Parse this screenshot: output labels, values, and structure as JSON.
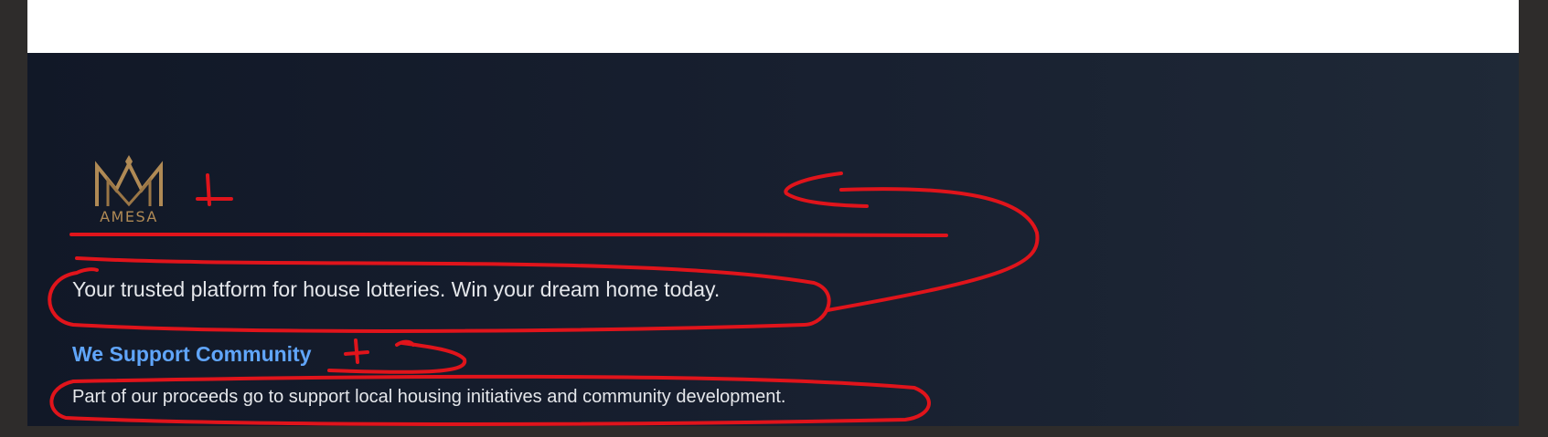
{
  "footer": {
    "logo": {
      "text": "AMESA",
      "icon": "crown-m-logo-icon"
    },
    "tagline": "Your trusted platform for house lotteries. Win your dream home today.",
    "support_heading": "We Support Community",
    "support_text": "Part of our proceeds go to support local housing initiatives and community development."
  },
  "colors": {
    "footer_background": "#111827",
    "logo_gold": "#b08a55",
    "heading_blue": "#60a5fa",
    "annotation_red": "#e0141b"
  }
}
